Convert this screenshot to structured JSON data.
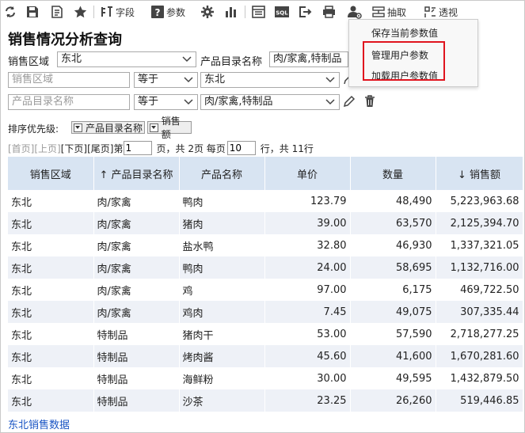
{
  "toolbar": {
    "field_label": "字段",
    "param_label": "参数",
    "extract_label": "抽取",
    "pivot_label": "透视",
    "sql_label": "SQL"
  },
  "page_title": "销售情况分析查询",
  "params": {
    "region_label": "销售区域",
    "region_value": "东北",
    "category_label": "产品目录名称",
    "category_value": "肉/家禽,特制品"
  },
  "filters": [
    {
      "field_placeholder": "销售区域",
      "operator": "等于",
      "value": "东北"
    },
    {
      "field_placeholder": "产品目录名称",
      "operator": "等于",
      "value": "肉/家禽,特制品"
    }
  ],
  "sort": {
    "label": "排序优先级:",
    "items": [
      "产品目录名称",
      "销售额"
    ]
  },
  "pager": {
    "first": "[首页]",
    "prev": "[上页]",
    "next": "[下页]",
    "last": "[尾页]",
    "page_prefix": "第",
    "current_page": "1",
    "page_suffix": "页，共 2页 每页",
    "page_size": "10",
    "total_suffix": "行，共 11行"
  },
  "table": {
    "headers": [
      "销售区域",
      "↑ 产品目录名称",
      "产品名称",
      "单价",
      "数量",
      "↓ 销售额"
    ],
    "rows": [
      [
        "东北",
        "肉/家禽",
        "鸭肉",
        "123.79",
        "48,490",
        "5,223,963.68"
      ],
      [
        "东北",
        "肉/家禽",
        "猪肉",
        "39.00",
        "63,570",
        "2,125,394.70"
      ],
      [
        "东北",
        "肉/家禽",
        "盐水鸭",
        "32.80",
        "46,930",
        "1,337,321.05"
      ],
      [
        "东北",
        "肉/家禽",
        "鸭肉",
        "24.00",
        "58,695",
        "1,132,716.00"
      ],
      [
        "东北",
        "肉/家禽",
        "鸡",
        "97.00",
        "6,175",
        "469,722.50"
      ],
      [
        "东北",
        "肉/家禽",
        "鸡肉",
        "7.45",
        "49,075",
        "307,335.44"
      ],
      [
        "东北",
        "特制品",
        "猪肉干",
        "53.00",
        "57,590",
        "2,718,277.25"
      ],
      [
        "东北",
        "特制品",
        "烤肉酱",
        "45.60",
        "41,600",
        "1,670,281.60"
      ],
      [
        "东北",
        "特制品",
        "海鲜粉",
        "30.00",
        "49,595",
        "1,432,879.50"
      ],
      [
        "东北",
        "特制品",
        "沙茶",
        "23.25",
        "26,260",
        "519,446.85"
      ]
    ]
  },
  "footer_link": "东北销售数据",
  "dropdown": {
    "items": [
      "保存当前参数值",
      "管理用户参数",
      "加载用户参数值"
    ]
  },
  "colors": {
    "header_bg": "#d8e4f2",
    "stripe": "#eef1f7",
    "link": "#1a55c4",
    "highlight": "#e0141e"
  }
}
